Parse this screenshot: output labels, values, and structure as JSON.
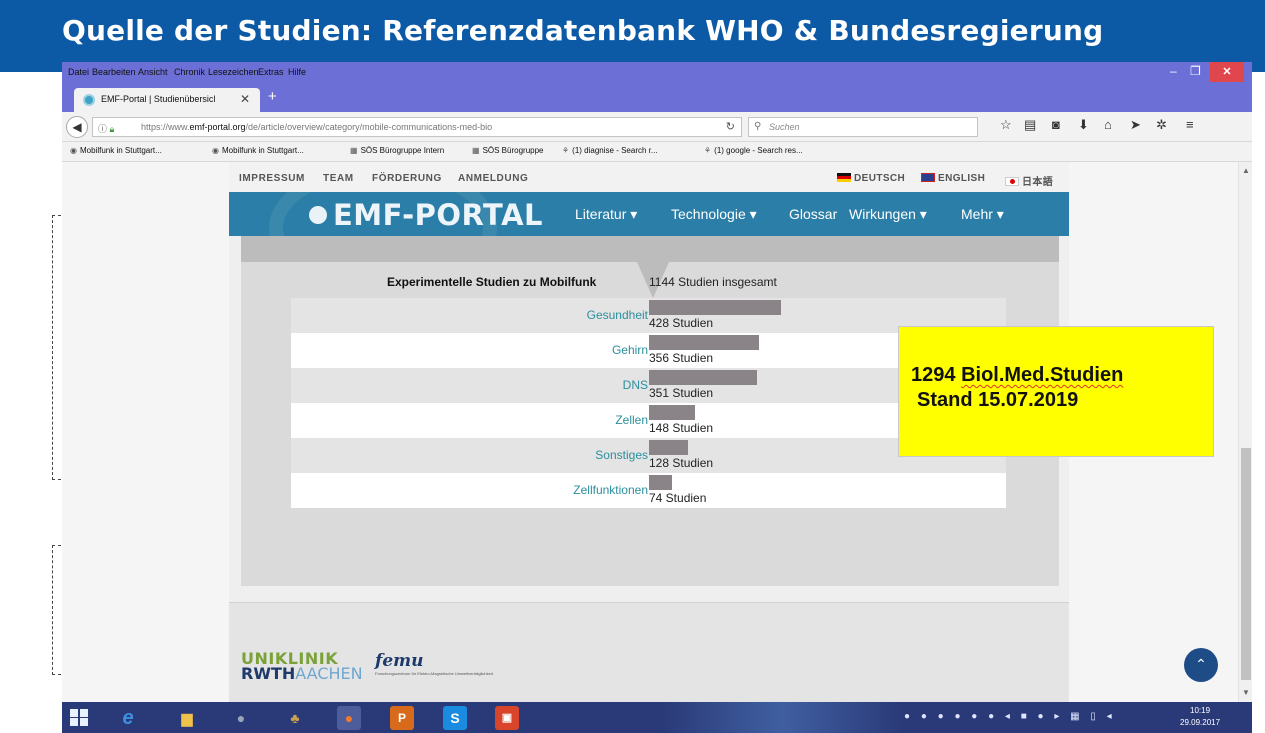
{
  "slide": {
    "title": "Quelle der Studien: Referenzdatenbank WHO & Bundesregierung",
    "brand_color": "#0c5aa6"
  },
  "browser": {
    "menu": [
      "Datei",
      "Bearbeiten",
      "Ansicht",
      "Chronik",
      "Lesezeichen",
      "Extras",
      "Hilfe"
    ],
    "tab": {
      "title": "EMF-Portal | Studienübersicl",
      "close": "✕",
      "new_tab": "+"
    },
    "url": {
      "prefix": "https://www.",
      "host": "emf-portal.org",
      "path": "/de/article/overview/category/mobile-communications-med-bio"
    },
    "search_placeholder": "Suchen",
    "bookmarks": [
      {
        "label": "Mobilfunk in Stuttgart...",
        "icon": "globe-icon"
      },
      {
        "label": "Mobilfunk in Stuttgart...",
        "icon": "globe-icon"
      },
      {
        "label": "SÖS Bürogruppe Intern",
        "icon": "grid-icon"
      },
      {
        "label": "SÖS Bürogruppe",
        "icon": "grid-icon"
      },
      {
        "label": "(1) diagnise - Search r...",
        "icon": "search-icon"
      },
      {
        "label": "(1) google - Search res...",
        "icon": "search-icon"
      }
    ]
  },
  "site": {
    "top_nav": [
      "IMPRESSUM",
      "TEAM",
      "FÖRDERUNG",
      "ANMELDUNG"
    ],
    "languages": [
      "DEUTSCH",
      "ENGLISH",
      "日本語"
    ],
    "logo": "EMF-PORTAL",
    "main_nav": [
      "Literatur ▾",
      "Technologie ▾",
      "Glossar",
      "Wirkungen ▾",
      "Mehr ▾"
    ],
    "accent_color": "#2b7ea7",
    "link_color": "#2b8f9e",
    "footer": {
      "logo1_line1": "UNIKLINIK",
      "logo1_line2a": "RWTH",
      "logo1_line2b": "AACHEN",
      "logo2": "femu",
      "logo2_sub": "Forschungszentrum für Elektro-Magnetische Umweltverträglichkeit"
    }
  },
  "chart_data": {
    "type": "bar",
    "title": "Experimentelle Studien zu Mobilfunk",
    "total_label": "1144 Studien insgesamt",
    "categories": [
      "Gesundheit",
      "Gehirn",
      "DNS",
      "Zellen",
      "Sonstiges",
      "Zellfunktionen"
    ],
    "values": [
      428,
      356,
      351,
      148,
      128,
      74
    ],
    "value_labels": [
      "428 Studien",
      "356 Studien",
      "351 Studien",
      "148 Studien",
      "128 Studien",
      "74 Studien"
    ],
    "bar_color": "#8a8488"
  },
  "callout": {
    "line1_num": "1294",
    "line1_text": "Biol.Med.Studien",
    "line2": "Stand 15.07.2019"
  },
  "taskbar": {
    "clock_time": "10:19",
    "clock_date": "29.09.2017"
  }
}
